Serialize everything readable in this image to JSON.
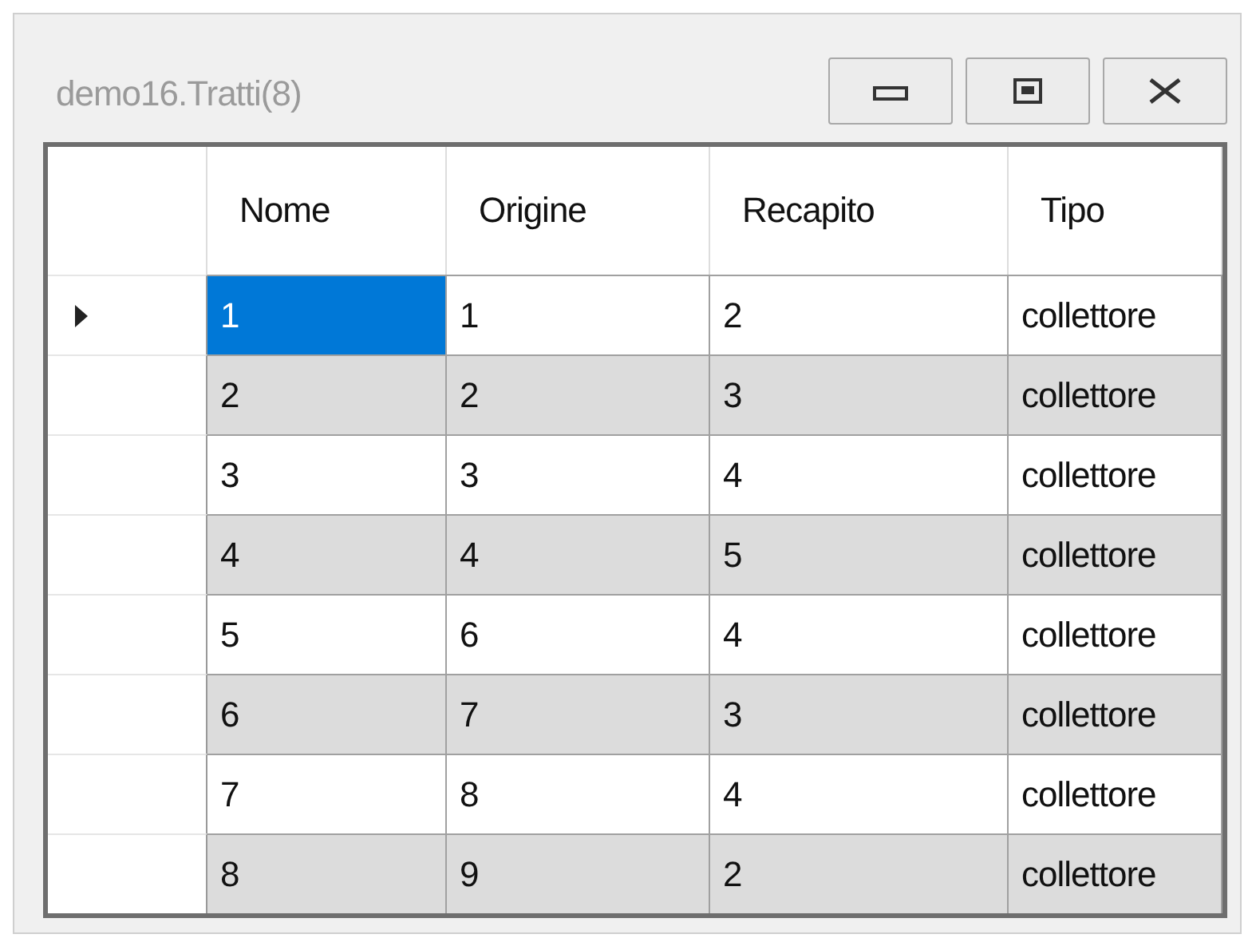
{
  "window": {
    "title": "demo16.Tratti(8)"
  },
  "table": {
    "columns": [
      "Nome",
      "Origine",
      "Recapito",
      "Tipo"
    ],
    "rows": [
      {
        "current": true,
        "cells": [
          {
            "text": "1",
            "selected": true
          },
          {
            "text": "1",
            "selected": false
          },
          {
            "text": "2",
            "selected": false
          },
          {
            "text": "collettore",
            "selected": false
          }
        ]
      },
      {
        "current": false,
        "cells": [
          {
            "text": "2",
            "selected": false
          },
          {
            "text": "2",
            "selected": false
          },
          {
            "text": "3",
            "selected": false
          },
          {
            "text": "collettore",
            "selected": false
          }
        ]
      },
      {
        "current": false,
        "cells": [
          {
            "text": "3",
            "selected": false
          },
          {
            "text": "3",
            "selected": false
          },
          {
            "text": "4",
            "selected": false
          },
          {
            "text": "collettore",
            "selected": false
          }
        ]
      },
      {
        "current": false,
        "cells": [
          {
            "text": "4",
            "selected": false
          },
          {
            "text": "4",
            "selected": false
          },
          {
            "text": "5",
            "selected": false
          },
          {
            "text": "collettore",
            "selected": false
          }
        ]
      },
      {
        "current": false,
        "cells": [
          {
            "text": "5",
            "selected": false
          },
          {
            "text": "6",
            "selected": false
          },
          {
            "text": "4",
            "selected": false
          },
          {
            "text": "collettore",
            "selected": false
          }
        ]
      },
      {
        "current": false,
        "cells": [
          {
            "text": "6",
            "selected": false
          },
          {
            "text": "7",
            "selected": false
          },
          {
            "text": "3",
            "selected": false
          },
          {
            "text": "collettore",
            "selected": false
          }
        ]
      },
      {
        "current": false,
        "cells": [
          {
            "text": "7",
            "selected": false
          },
          {
            "text": "8",
            "selected": false
          },
          {
            "text": "4",
            "selected": false
          },
          {
            "text": "collettore",
            "selected": false
          }
        ]
      },
      {
        "current": false,
        "cells": [
          {
            "text": "8",
            "selected": false
          },
          {
            "text": "9",
            "selected": false
          },
          {
            "text": "2",
            "selected": false
          },
          {
            "text": "collettore",
            "selected": false
          }
        ]
      }
    ]
  }
}
